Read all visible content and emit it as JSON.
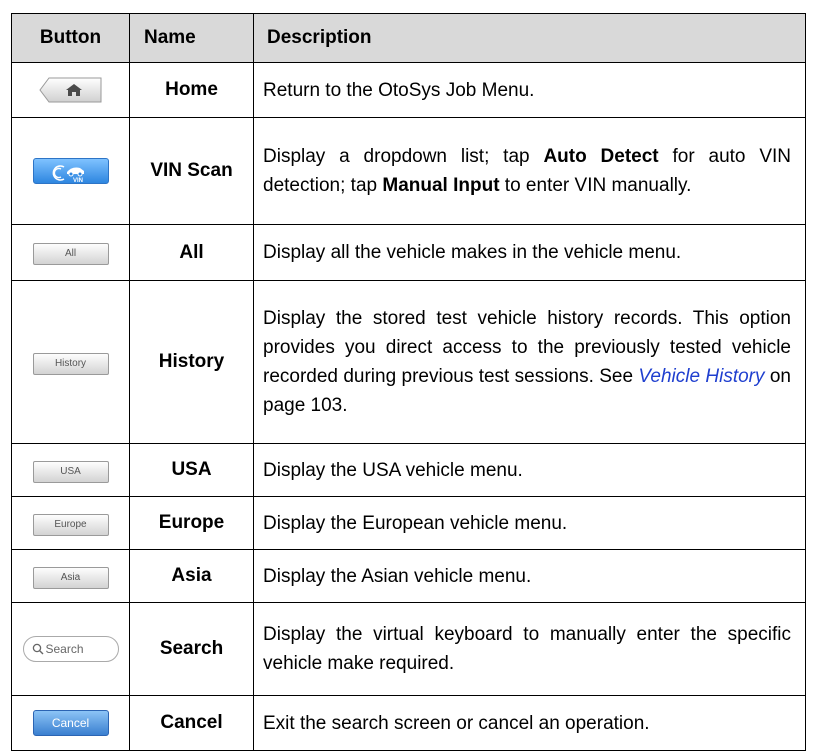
{
  "headers": {
    "button": "Button",
    "name": "Name",
    "description": "Description"
  },
  "rows": [
    {
      "button": "",
      "button_icon": "home-icon",
      "name": "Home",
      "desc": "Return to the OtoSys Job Menu."
    },
    {
      "button": "VIN",
      "button_icon": "vin-scan-icon",
      "name": "VIN Scan",
      "desc_1": "Display a dropdown list; tap ",
      "desc_b1": "Auto Detect",
      "desc_2": " for auto VIN detection; tap ",
      "desc_b2": "Manual Input",
      "desc_3": " to enter VIN manually."
    },
    {
      "button": "All",
      "name": "All",
      "desc": "Display all the vehicle makes in the vehicle menu."
    },
    {
      "button": "History",
      "name": "History",
      "desc_1": "Display the stored test vehicle history records. This option provides you direct access to the previously tested vehicle recorded during previous test sessions. See ",
      "desc_link": "Vehicle History",
      "desc_2": " on page 103."
    },
    {
      "button": "USA",
      "name": "USA",
      "desc": "Display the USA vehicle menu."
    },
    {
      "button": "Europe",
      "name": "Europe",
      "desc": "Display the European vehicle menu."
    },
    {
      "button": "Asia",
      "name": "Asia",
      "desc": "Display the Asian vehicle menu."
    },
    {
      "button": "Search",
      "button_icon": "search-icon",
      "name": "Search",
      "desc": "Display the virtual keyboard to manually enter the specific vehicle make required."
    },
    {
      "button": "Cancel",
      "name": "Cancel",
      "desc": "Exit the search screen or cancel an operation."
    }
  ]
}
